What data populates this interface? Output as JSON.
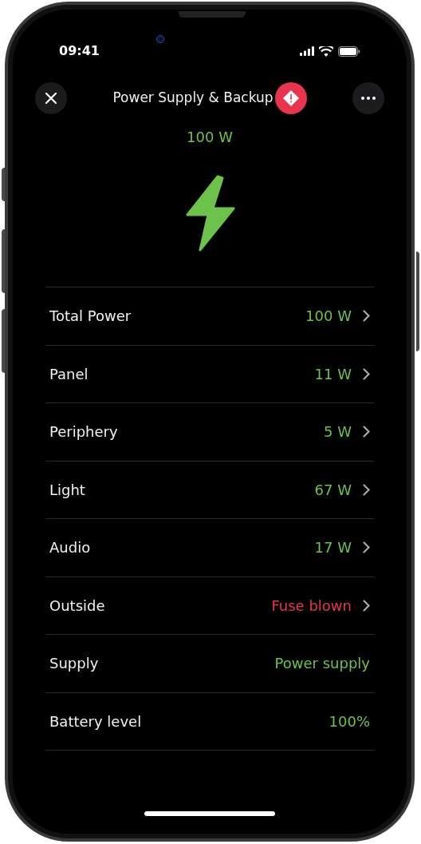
{
  "status_bar": {
    "time": "09:41"
  },
  "header": {
    "title": "Power Supply & Backup",
    "alert": true
  },
  "summary": {
    "value": "100 W",
    "color": "#6cc24a"
  },
  "rows": [
    {
      "label": "Total Power",
      "value": "100 W",
      "color": "#6cc24a",
      "chevron": true
    },
    {
      "label": "Panel",
      "value": "11 W",
      "color": "#6cc24a",
      "chevron": true
    },
    {
      "label": "Periphery",
      "value": "5 W",
      "color": "#6cc24a",
      "chevron": true
    },
    {
      "label": "Light",
      "value": "67 W",
      "color": "#6cc24a",
      "chevron": true
    },
    {
      "label": "Audio",
      "value": "17 W",
      "color": "#6cc24a",
      "chevron": true
    },
    {
      "label": "Outside",
      "value": "Fuse blown",
      "color": "#e8344e",
      "chevron": true
    },
    {
      "label": "Supply",
      "value": "Power supply",
      "color": "#6cc24a",
      "chevron": false
    },
    {
      "label": "Battery level",
      "value": "100%",
      "color": "#6cc24a",
      "chevron": false
    }
  ]
}
